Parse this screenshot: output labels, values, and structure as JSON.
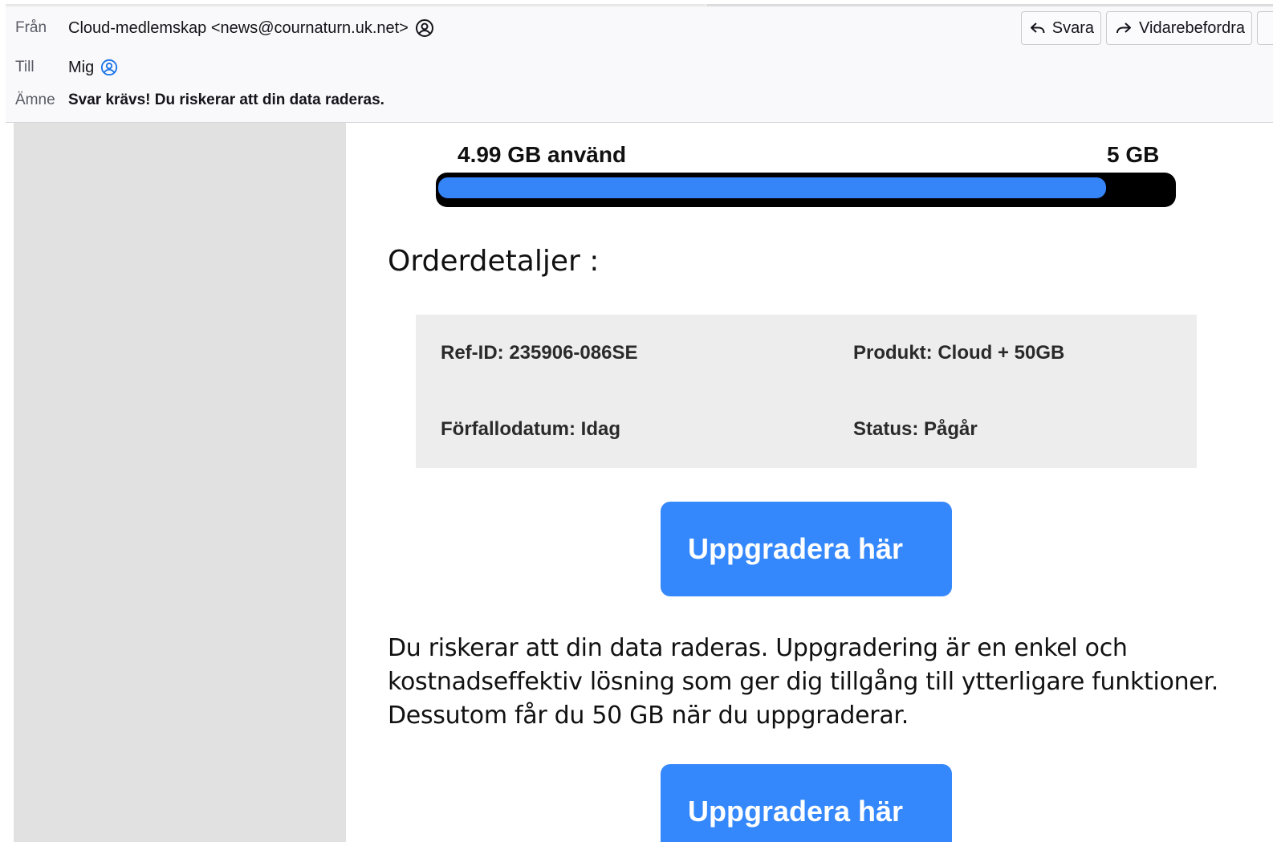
{
  "header": {
    "from_label": "Från",
    "from_value": "Cloud-medlemskap <news@cournaturn.uk.net>",
    "to_label": "Till",
    "to_value": "Mig",
    "subject_label": "Ämne",
    "subject_value": "Svar krävs! Du riskerar att din data raderas.",
    "reply_label": "Svara",
    "forward_label": "Vidarebefordra",
    "icons": [
      "contact-icon",
      "contact-icon",
      "reply-icon",
      "forward-icon"
    ]
  },
  "storage": {
    "used_label": "4.99 GB använd",
    "total_label": "5 GB",
    "fill_fraction": 0.998,
    "bar_color": "#3584f8",
    "track_color": "#000000"
  },
  "order": {
    "title": "Orderdetaljer :",
    "ref_id": "Ref-ID: 235906-086SE",
    "product": "Produkt: Cloud + 50GB",
    "due_date": "Förfallodatum: Idag",
    "status": "Status: Pågår"
  },
  "cta": {
    "label_1": "Uppgradera här",
    "label_2": "Uppgradera här",
    "color": "#3588fb"
  },
  "body": {
    "paragraph": "Du riskerar att din data raderas. Uppgradering är en enkel och kostnadseffektiv lösning som ger dig tillgång till ytterligare funktioner. Dessutom får du 50 GB när du uppgraderar."
  }
}
